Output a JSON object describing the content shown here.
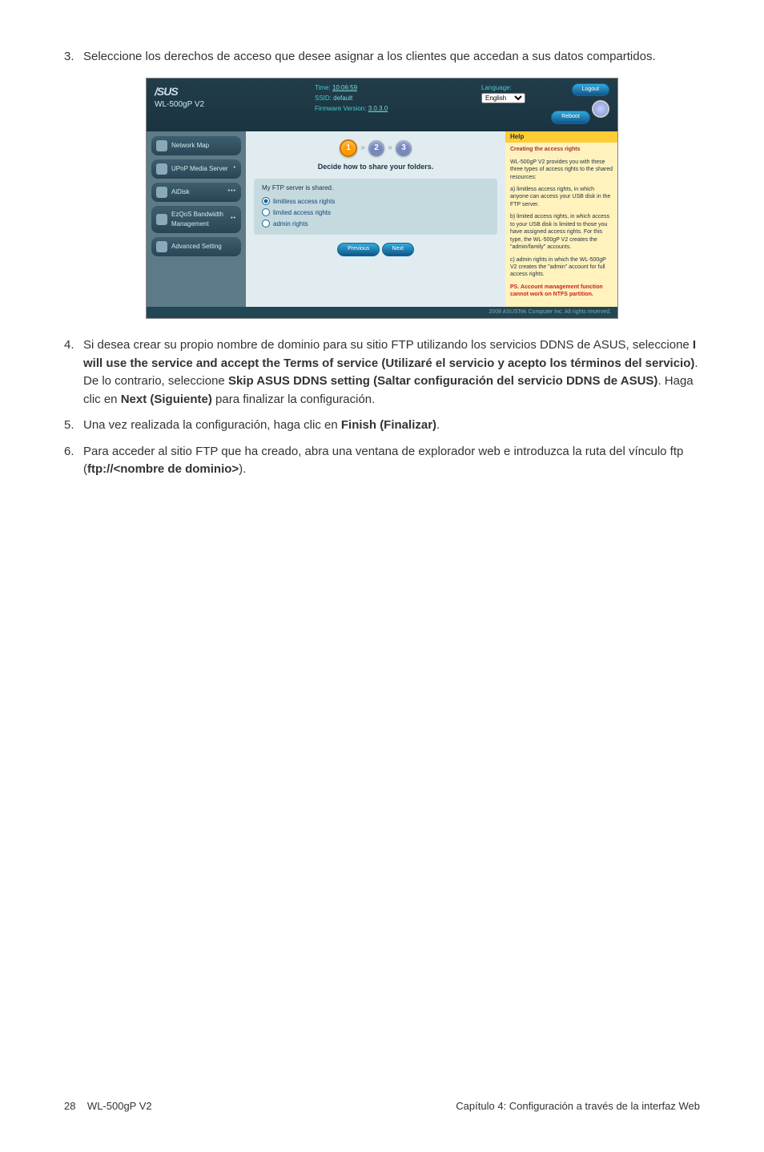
{
  "step3": {
    "num": "3.",
    "text": "Seleccione los derechos de acceso que desee asignar a los clientes que accedan a sus datos compartidos."
  },
  "router": {
    "brand": "/SUS",
    "model": "WL-500gP V2",
    "time_label": "Time:",
    "time_val": "10:06:59",
    "ssid_label": "SSID:",
    "ssid_val": "default",
    "fw_label": "Firmware Version:",
    "fw_val": "3.0.3.0",
    "lang_label": "Language:",
    "lang_val": "English",
    "logout": "Logout",
    "reboot": "Reboot",
    "side": [
      {
        "label": "Network Map",
        "dots": ""
      },
      {
        "label": "UPnP Media Server",
        "dots": "•"
      },
      {
        "label": "AiDisk",
        "dots": "•••"
      },
      {
        "label": "EzQoS Bandwidth Management",
        "dots": "••"
      },
      {
        "label": "Advanced Setting",
        "dots": ""
      }
    ],
    "steps": [
      "1",
      "2",
      "3"
    ],
    "main_title": "Decide how to share your folders.",
    "panel_title": "My FTP server is shared.",
    "radios": [
      {
        "label": "limitless access rights",
        "sel": true
      },
      {
        "label": "limited access rights",
        "sel": false
      },
      {
        "label": "admin rights",
        "sel": false
      }
    ],
    "prev": "Previous",
    "next": "Next",
    "help_hdr": "Help",
    "help_title": "Creating the access rights",
    "help_p1": "WL-500gP V2 provides you with these three types of access rights to the shared resources:",
    "help_a": "a) limitless access rights, in which anyone can access your USB disk in the FTP server.",
    "help_b": "b) limited access rights, in which access to your USB disk is limited to those you have assigned access rights. For this type, the WL-500gP V2 creates the \"admin/family\" accounts.",
    "help_c": "c) admin rights in which the WL-500gP V2 creates the \"admin\" account for full access rights.",
    "help_ps": "PS. Account management function cannot work on NTFS partition.",
    "footer": "2008 ASUSTek Computer Inc. All rights reserved."
  },
  "step4": {
    "num": "4.",
    "pre": "Si desea crear su propio nombre de dominio para su sitio FTP utilizando los servicios DDNS de ASUS, seleccione ",
    "b1": "I will use the service and accept the Terms of service (Utilizaré el servicio y acepto los términos del servicio)",
    "mid1": ". De lo contrario, seleccione ",
    "b2": "Skip ASUS DDNS setting (Saltar configuración del servicio DDNS de ASUS)",
    "mid2": ". Haga clic en ",
    "b3": "Next (Siguiente)",
    "post": " para finalizar la configuración."
  },
  "step5": {
    "num": "5.",
    "pre": "Una vez realizada la configuración, haga clic en ",
    "b1": "Finish (Finalizar)",
    "post": "."
  },
  "step6": {
    "num": "6.",
    "pre": "Para acceder al sitio FTP que ha creado, abra una ventana de explorador web e introduzca la ruta del vínculo ftp (",
    "b1": "ftp://<nombre de dominio>",
    "post": ")."
  },
  "footer": {
    "page": "28",
    "model": "WL-500gP V2",
    "chapter": "Capítulo 4: Configuración a través de la interfaz Web"
  }
}
